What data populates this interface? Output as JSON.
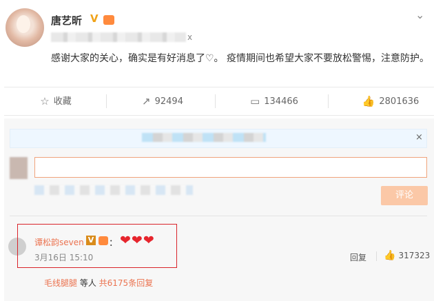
{
  "post": {
    "author": "唐艺昕",
    "verified_icon": "V",
    "meta_suffix": "x",
    "close_icon": "⌄",
    "text": "感谢大家的关心，确实是有好消息了♡。 疫情期间也希望大家不要放松警惕，注意防护。"
  },
  "actions": {
    "favorite_label": "收藏",
    "repost_count": "92494",
    "comment_count": "134466",
    "like_count": "2801636"
  },
  "compose": {
    "notice_close": "×",
    "input_value": "",
    "submit_label": "评论"
  },
  "comment": {
    "username": "谭松韵seven",
    "verified_icon": "V",
    "colon": "：",
    "hearts": "❤❤❤",
    "timestamp": "3月16日 15:10",
    "reply_label": "回复",
    "like_count": "317323"
  },
  "replies": {
    "first_user": "毛线腿腿",
    "middle": " 等人 ",
    "total": "共6175条回复"
  },
  "colors": {
    "accent": "#eb7350",
    "highlight_border": "#d9232a",
    "submit_bg": "#fbc8a7"
  }
}
